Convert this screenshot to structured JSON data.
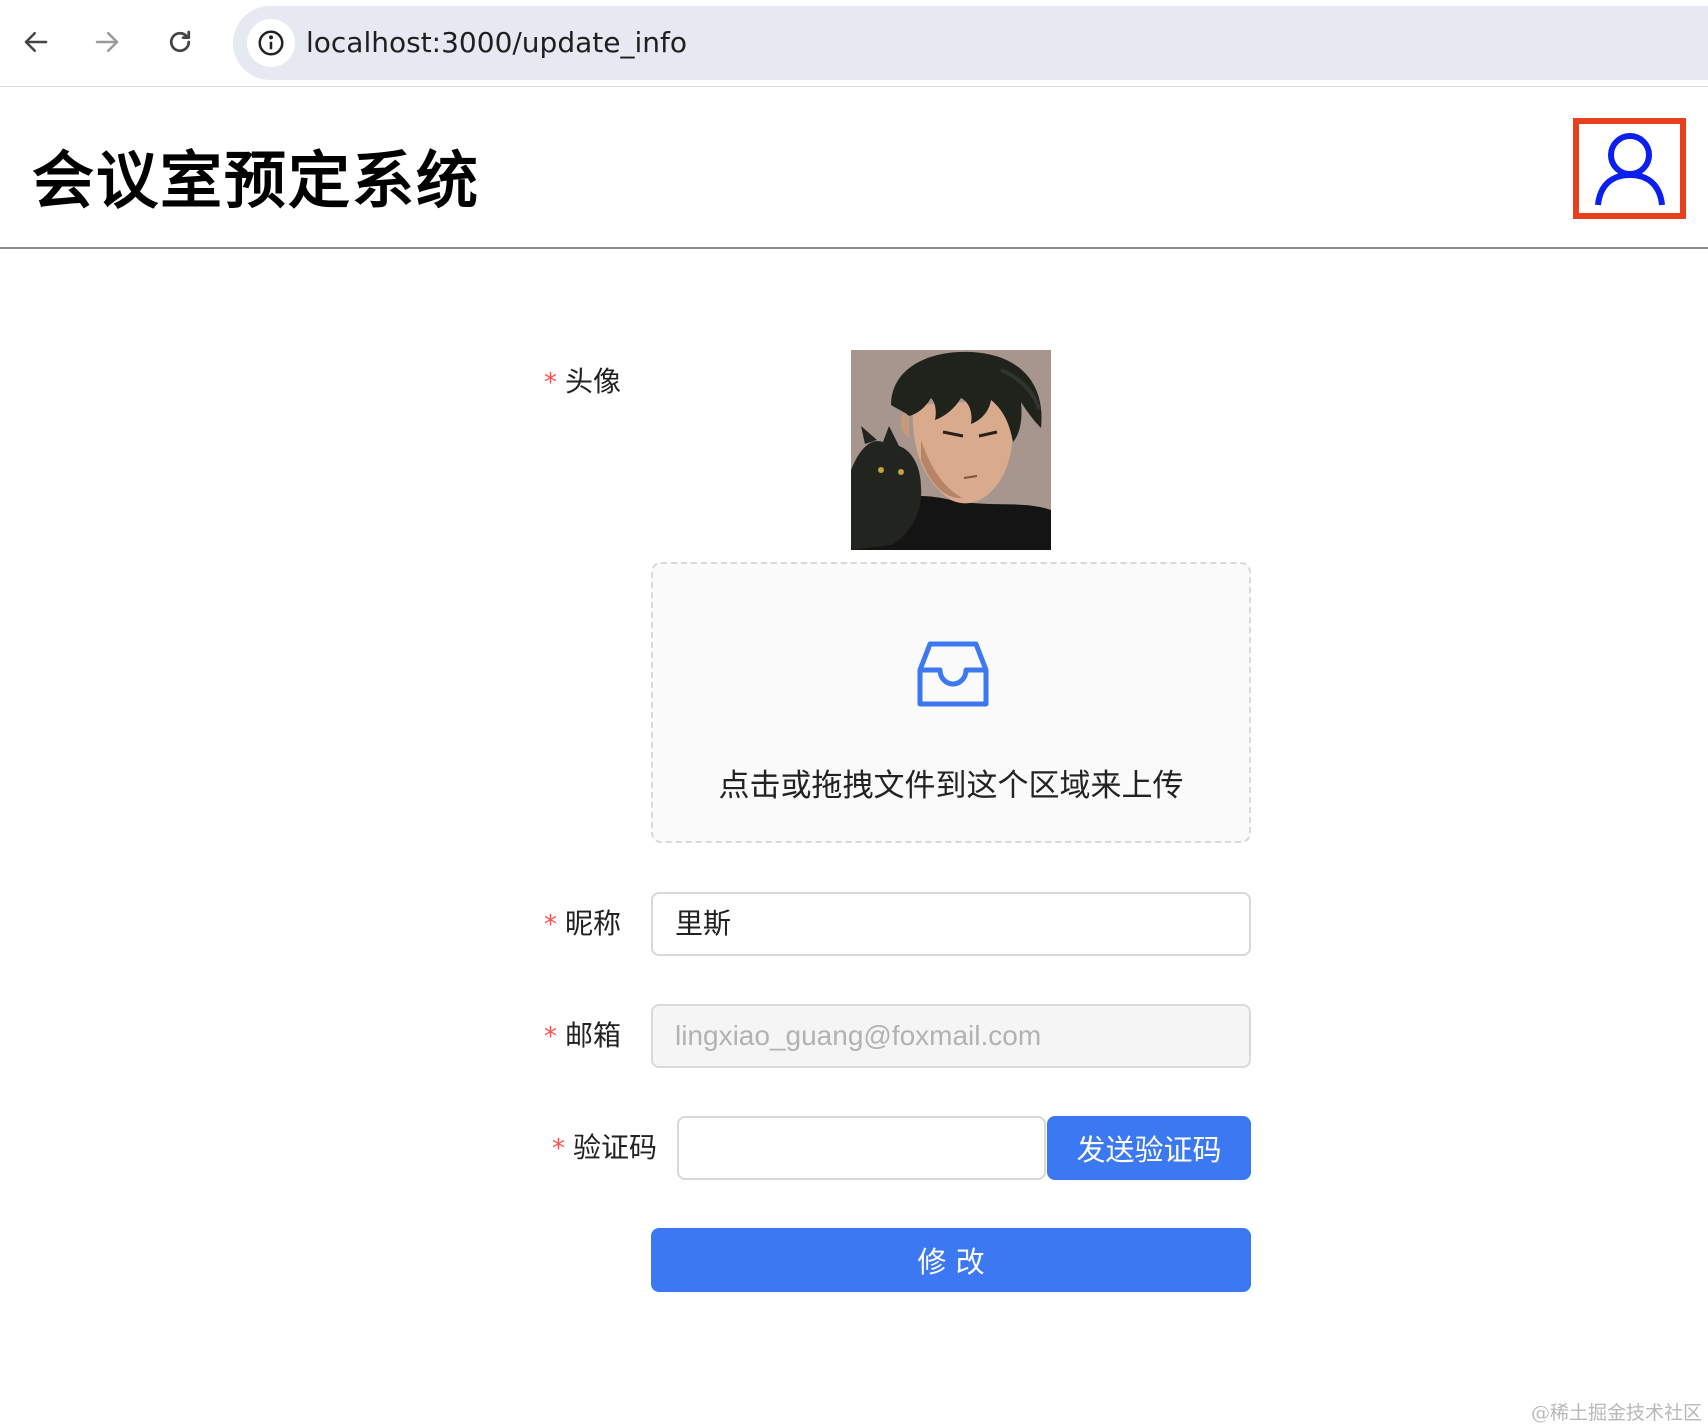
{
  "browser": {
    "url": "localhost:3000/update_info"
  },
  "header": {
    "title": "会议室预定系统"
  },
  "form": {
    "avatar_label": "头像",
    "upload_hint": "点击或拖拽文件到这个区域来上传",
    "nickname_label": "昵称",
    "nickname_value": "里斯",
    "email_label": "邮箱",
    "email_value": "lingxiao_guang@foxmail.com",
    "captcha_label": "验证码",
    "captcha_value": "",
    "send_captcha_label": "发送验证码",
    "submit_label": "修 改",
    "required_mark": "*"
  },
  "watermark": "@稀土掘金技术社区",
  "colors": {
    "primary": "#3b78f2",
    "required": "#ff4d4f",
    "user_icon_border": "#e8401c",
    "user_icon_stroke": "#0a1ff0"
  }
}
